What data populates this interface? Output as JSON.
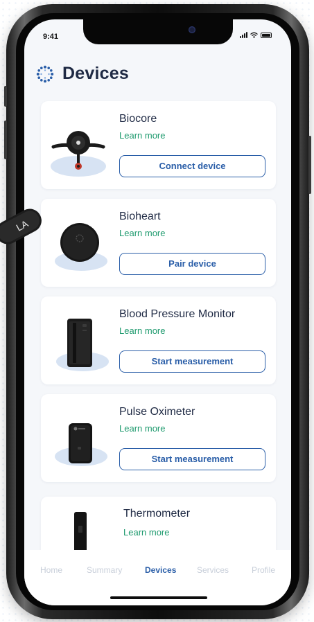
{
  "status_bar": {
    "time": "9:41"
  },
  "header": {
    "title": "Devices"
  },
  "devices": [
    {
      "name": "Biocore",
      "link": "Learn more",
      "action": "Connect device"
    },
    {
      "name": "Bioheart",
      "link": "Learn more",
      "action": "Pair device"
    },
    {
      "name": "Blood Pressure Monitor",
      "link": "Learn more",
      "action": "Start measurement"
    },
    {
      "name": "Pulse Oximeter",
      "link": "Learn more",
      "action": "Start measurement"
    },
    {
      "name": "Thermometer",
      "link": "Learn more"
    }
  ],
  "tabs": [
    {
      "label": "Home"
    },
    {
      "label": "Summary"
    },
    {
      "label": "Devices"
    },
    {
      "label": "Services"
    },
    {
      "label": "Profile"
    }
  ],
  "float_badge": {
    "label": "LA"
  },
  "colors": {
    "accent": "#2a5ea8",
    "link": "#1e9a6e",
    "title": "#1f2a44",
    "tab_inactive": "#c7ced9",
    "screen_bg": "#f5f7fa"
  },
  "icons": [
    "devices-logo-icon",
    "signal-icon",
    "wifi-icon",
    "battery-icon"
  ]
}
